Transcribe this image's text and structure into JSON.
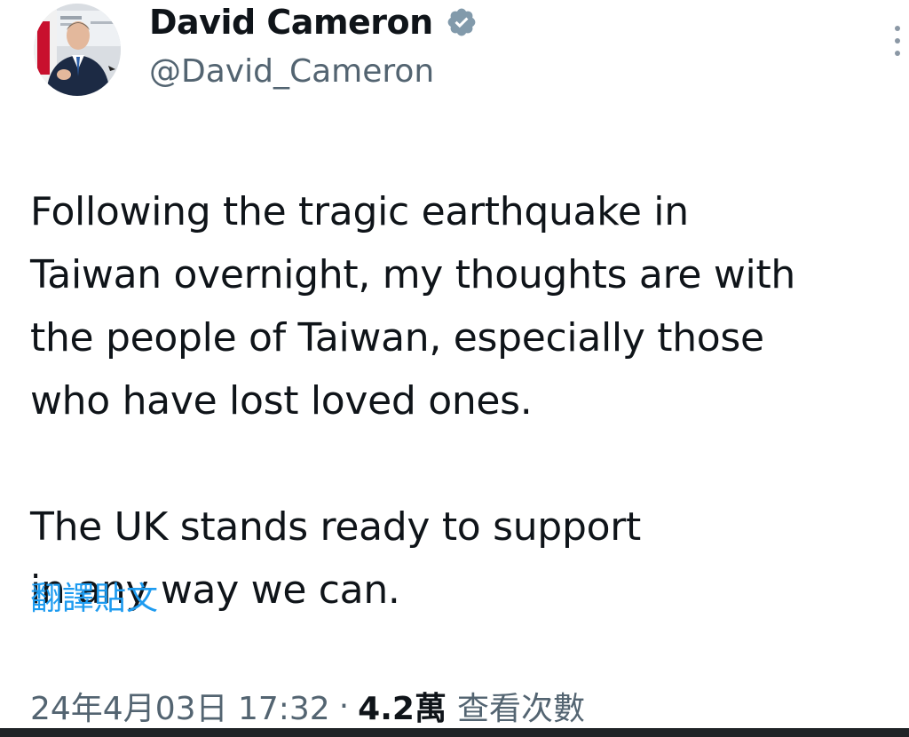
{
  "author": {
    "display_name": "David Cameron",
    "handle": "@David_Cameron",
    "verified": true
  },
  "tweet": {
    "text_paragraph_1": "Following the tragic earthquake in\nTaiwan overnight, my thoughts are with\nthe people of Taiwan, especially those\nwho have lost loved ones.",
    "text_paragraph_2": "The UK stands ready to support\nin any way we can.",
    "translate_label": "翻譯貼文"
  },
  "meta": {
    "timestamp": "24年4月03日 17:32",
    "separator": "·",
    "views_count": "4.2萬",
    "views_label": "查看次數"
  },
  "icons": {
    "verified": "verified-badge-icon",
    "more": "more-options-icon"
  },
  "colors": {
    "text": "#0f1419",
    "secondary": "#536471",
    "link": "#1d9bf0",
    "badge": "#829aab"
  }
}
